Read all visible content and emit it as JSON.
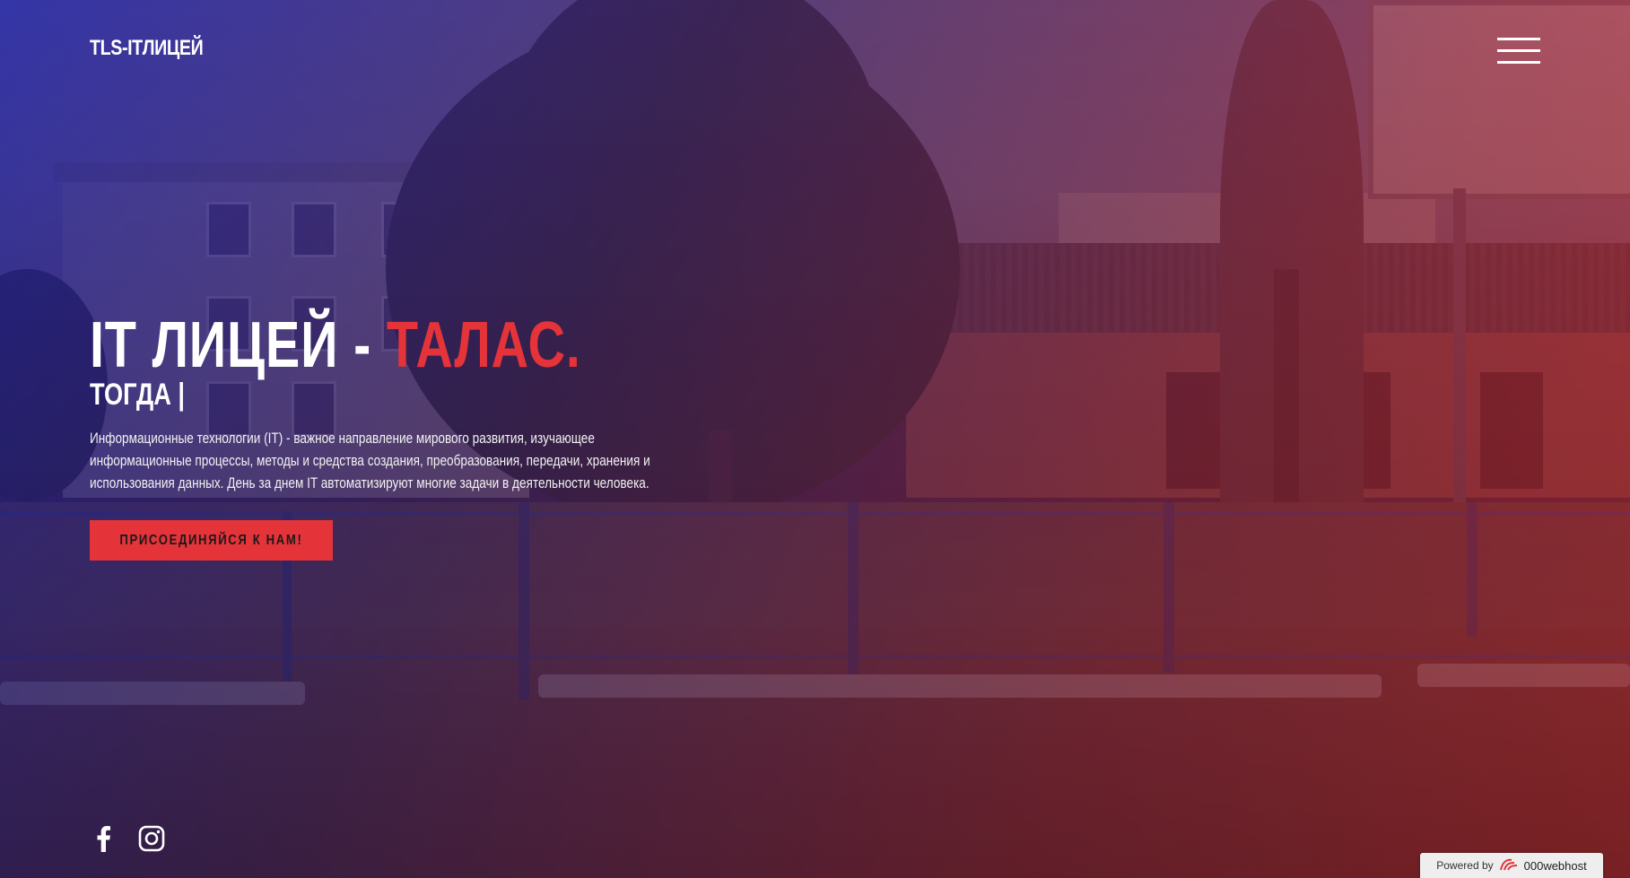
{
  "header": {
    "brand": "TLS-ITЛИЦЕЙ",
    "menu_icon": "hamburger-menu-icon"
  },
  "hero": {
    "title_main": "IT ЛИЦЕЙ - ",
    "title_accent": "ТАЛАС.",
    "subtitle": "ТОГДА |",
    "description": "Информационные технологии (IT) - важное направление мирового развития, изучающее информационные процессы, методы и средства создания, преобразования, передачи, хранения и использования данных. День за днем IT автоматизируют многие задачи в деятельности человека.",
    "cta_label": "ПРИСОЕДИНЯЙСЯ К НАМ!"
  },
  "social": [
    {
      "icon": "facebook-icon"
    },
    {
      "icon": "instagram-icon"
    }
  ],
  "footer_badge": {
    "prefix": "Powered by",
    "name": "000webhost",
    "icon": "000webhost-logo-icon"
  },
  "colors": {
    "accent": "#e5333a",
    "text": "#ffffff",
    "overlay_start": "#2828be",
    "overlay_end": "#dc2d37"
  }
}
